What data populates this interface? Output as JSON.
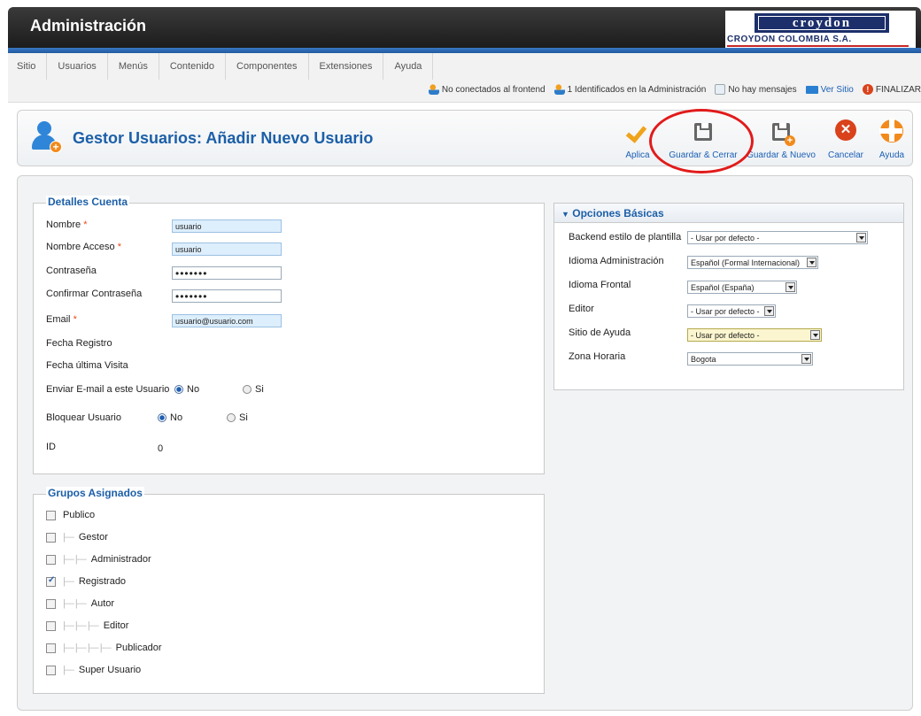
{
  "header": {
    "title": "Administración",
    "logo_word": "croydon",
    "logo_sub": "CROYDON COLOMBIA S.A."
  },
  "menu": {
    "items": [
      "Sitio",
      "Usuarios",
      "Menús",
      "Contenido",
      "Componentes",
      "Extensiones",
      "Ayuda"
    ]
  },
  "status": {
    "frontend": "No conectados al frontend",
    "admin": "1 Identificados en la Administración",
    "messages": "No hay mensajes",
    "view_site": "Ver Sitio",
    "logout": "FINALIZAR"
  },
  "toolbar": {
    "title": "Gestor Usuarios: Añadir Nuevo Usuario",
    "apply": "Aplica",
    "save_close": "Guardar & Cerrar",
    "save_new": "Guardar & Nuevo",
    "cancel": "Cancelar",
    "help": "Ayuda"
  },
  "account": {
    "legend": "Detalles Cuenta",
    "name_label": "Nombre",
    "name_value": "usuario",
    "username_label": "Nombre Acceso",
    "username_value": "usuario",
    "password_label": "Contraseña",
    "password_value": "•••••••",
    "confirm_label": "Confirmar Contraseña",
    "confirm_value": "•••••••",
    "email_label": "Email",
    "email_value": "usuario@usuario.com",
    "register_date_label": "Fecha Registro",
    "last_visit_label": "Fecha última Visita",
    "send_email_label": "Enviar E-mail a este Usuario",
    "block_label": "Bloquear Usuario",
    "no": "No",
    "si": "Si",
    "id_label": "ID",
    "id_value": "0",
    "required_mark": "*"
  },
  "groups": {
    "legend": "Grupos Asignados",
    "items": [
      {
        "label": "Publico",
        "tree": "",
        "checked": false
      },
      {
        "label": "Gestor",
        "tree": "|—",
        "checked": false
      },
      {
        "label": "Administrador",
        "tree": "|— |—",
        "checked": false
      },
      {
        "label": "Registrado",
        "tree": "|—",
        "checked": true
      },
      {
        "label": "Autor",
        "tree": "|— |—",
        "checked": false
      },
      {
        "label": "Editor",
        "tree": "|— |— |—",
        "checked": false
      },
      {
        "label": "Publicador",
        "tree": "|— |— |— |—",
        "checked": false
      },
      {
        "label": "Super Usuario",
        "tree": "|—",
        "checked": false
      }
    ]
  },
  "options": {
    "title": "Opciones Básicas",
    "backend_label": "Backend estilo de plantilla",
    "backend_value": "- Usar por defecto -",
    "admin_lang_label": "Idioma Administración",
    "admin_lang_value": "Español (Formal Internacional)",
    "front_lang_label": "Idioma Frontal",
    "front_lang_value": "Español (España)",
    "editor_label": "Editor",
    "editor_value": "- Usar por defecto -",
    "help_site_label": "Sitio de Ayuda",
    "help_site_value": "- Usar por defecto -",
    "timezone_label": "Zona Horaria",
    "timezone_value": "Bogota"
  },
  "colors": {
    "accent_blue": "#1c5fa8",
    "highlight_red": "#e11b1b",
    "orange": "#f28a1b"
  }
}
